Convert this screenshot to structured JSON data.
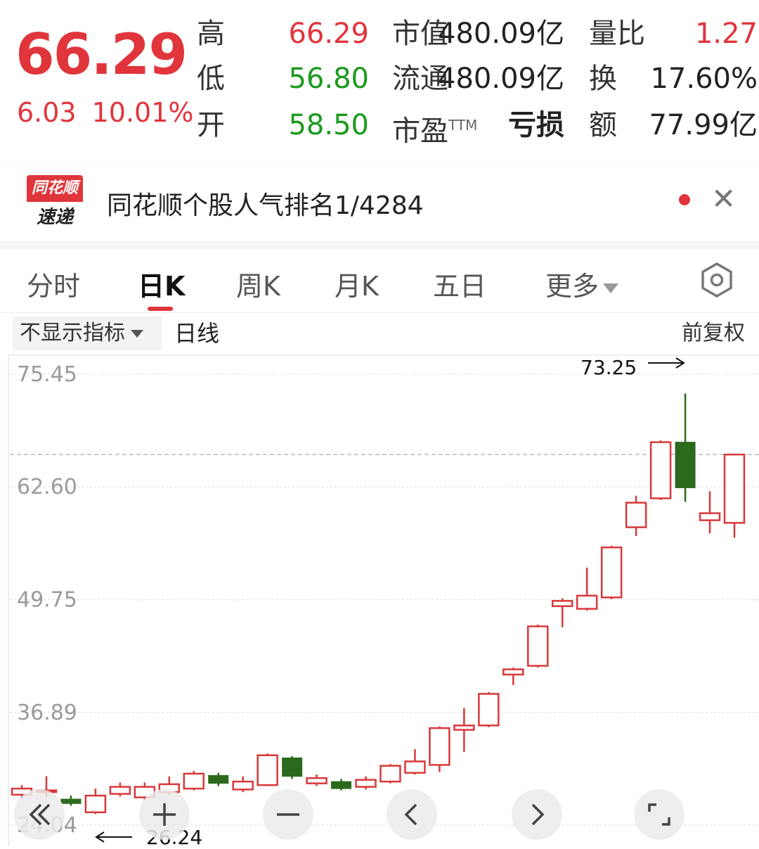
{
  "quote": {
    "price": "66.29",
    "change": "6.03",
    "change_pct": "10.01%",
    "high_label": "高",
    "high": "66.29",
    "low_label": "低",
    "low": "56.80",
    "open_label": "开",
    "open": "58.50",
    "mcap_label": "市值",
    "mcap": "480.09亿",
    "float_label": "流通",
    "float": "480.09亿",
    "pe_label": "市盈",
    "pe_sup": "TTM",
    "pe": "亏损",
    "vol_ratio_label": "量比",
    "vol_ratio": "1.27",
    "turnover_label": "换",
    "turnover": "17.60%",
    "amount_label": "额",
    "amount": "77.99亿"
  },
  "notice": {
    "logo_top": "同花顺",
    "logo_bottom": "速递",
    "text": "同花顺个股人气排名1/4284"
  },
  "tabs": [
    {
      "label": "分时"
    },
    {
      "label": "日K"
    },
    {
      "label": "周K"
    },
    {
      "label": "月K"
    },
    {
      "label": "五日"
    },
    {
      "label": "更多"
    }
  ],
  "indicator": {
    "select": "不显示指标",
    "period": "日线",
    "adjust": "前复权"
  },
  "chart_data": {
    "type": "candlestick",
    "y_ticks": [
      "75.45",
      "62.60",
      "49.75",
      "36.89",
      "24.04"
    ],
    "ylim": [
      24.04,
      75.45
    ],
    "annotation_high": "73.25",
    "annotation_low": "26.24",
    "last_price_line": 66.29,
    "candles": [
      {
        "o": 27.5,
        "c": 28.2,
        "h": 28.6,
        "l": 27.0
      },
      {
        "o": 27.8,
        "c": 28.0,
        "h": 29.6,
        "l": 27.2
      },
      {
        "o": 27.0,
        "c": 26.5,
        "h": 27.4,
        "l": 26.24
      },
      {
        "o": 25.5,
        "c": 27.4,
        "h": 28.2,
        "l": 25.3
      },
      {
        "o": 27.6,
        "c": 28.4,
        "h": 28.9,
        "l": 27.3
      },
      {
        "o": 27.2,
        "c": 28.4,
        "h": 28.9,
        "l": 26.9
      },
      {
        "o": 27.8,
        "c": 28.7,
        "h": 29.6,
        "l": 27.5
      },
      {
        "o": 28.2,
        "c": 29.9,
        "h": 30.2,
        "l": 28.0
      },
      {
        "o": 29.7,
        "c": 28.8,
        "h": 30.0,
        "l": 28.5
      },
      {
        "o": 28.1,
        "c": 29.0,
        "h": 29.6,
        "l": 27.8
      },
      {
        "o": 28.6,
        "c": 32.0,
        "h": 32.2,
        "l": 28.5
      },
      {
        "o": 31.7,
        "c": 29.6,
        "h": 31.9,
        "l": 29.3
      },
      {
        "o": 28.8,
        "c": 29.4,
        "h": 29.8,
        "l": 28.5
      },
      {
        "o": 29.0,
        "c": 28.2,
        "h": 29.3,
        "l": 28.0
      },
      {
        "o": 28.4,
        "c": 29.2,
        "h": 29.6,
        "l": 28.1
      },
      {
        "o": 29.0,
        "c": 30.8,
        "h": 31.0,
        "l": 28.8
      },
      {
        "o": 30.0,
        "c": 31.3,
        "h": 32.7,
        "l": 29.8
      },
      {
        "o": 30.9,
        "c": 35.1,
        "h": 35.3,
        "l": 30.1
      },
      {
        "o": 34.9,
        "c": 35.4,
        "h": 37.4,
        "l": 32.4
      },
      {
        "o": 35.4,
        "c": 39.0,
        "h": 39.2,
        "l": 35.2
      },
      {
        "o": 41.2,
        "c": 41.8,
        "h": 42.0,
        "l": 40.0
      },
      {
        "o": 42.2,
        "c": 46.7,
        "h": 46.9,
        "l": 42.0
      },
      {
        "o": 49.0,
        "c": 49.6,
        "h": 49.9,
        "l": 46.6
      },
      {
        "o": 48.7,
        "c": 50.2,
        "h": 53.4,
        "l": 48.5
      },
      {
        "o": 50.0,
        "c": 55.7,
        "h": 55.9,
        "l": 49.8
      },
      {
        "o": 58.0,
        "c": 60.8,
        "h": 61.6,
        "l": 57.0
      },
      {
        "o": 61.3,
        "c": 67.7,
        "h": 67.9,
        "l": 61.1
      },
      {
        "o": 67.7,
        "c": 62.5,
        "h": 73.25,
        "l": 60.9
      },
      {
        "o": 58.8,
        "c": 59.6,
        "h": 62.1,
        "l": 57.3
      },
      {
        "o": 58.5,
        "c": 66.29,
        "h": 66.29,
        "l": 56.8
      }
    ]
  },
  "controls": [
    {
      "icon": "double-left-icon"
    },
    {
      "icon": "plus-icon"
    },
    {
      "icon": "minus-icon"
    },
    {
      "icon": "chevron-left-icon"
    },
    {
      "icon": "chevron-right-icon"
    },
    {
      "icon": "fullscreen-icon"
    }
  ],
  "colors": {
    "up": "#d8393a",
    "down": "#2b6a1c",
    "price_red": "#e0353b",
    "value_green": "#1b9a1e"
  }
}
